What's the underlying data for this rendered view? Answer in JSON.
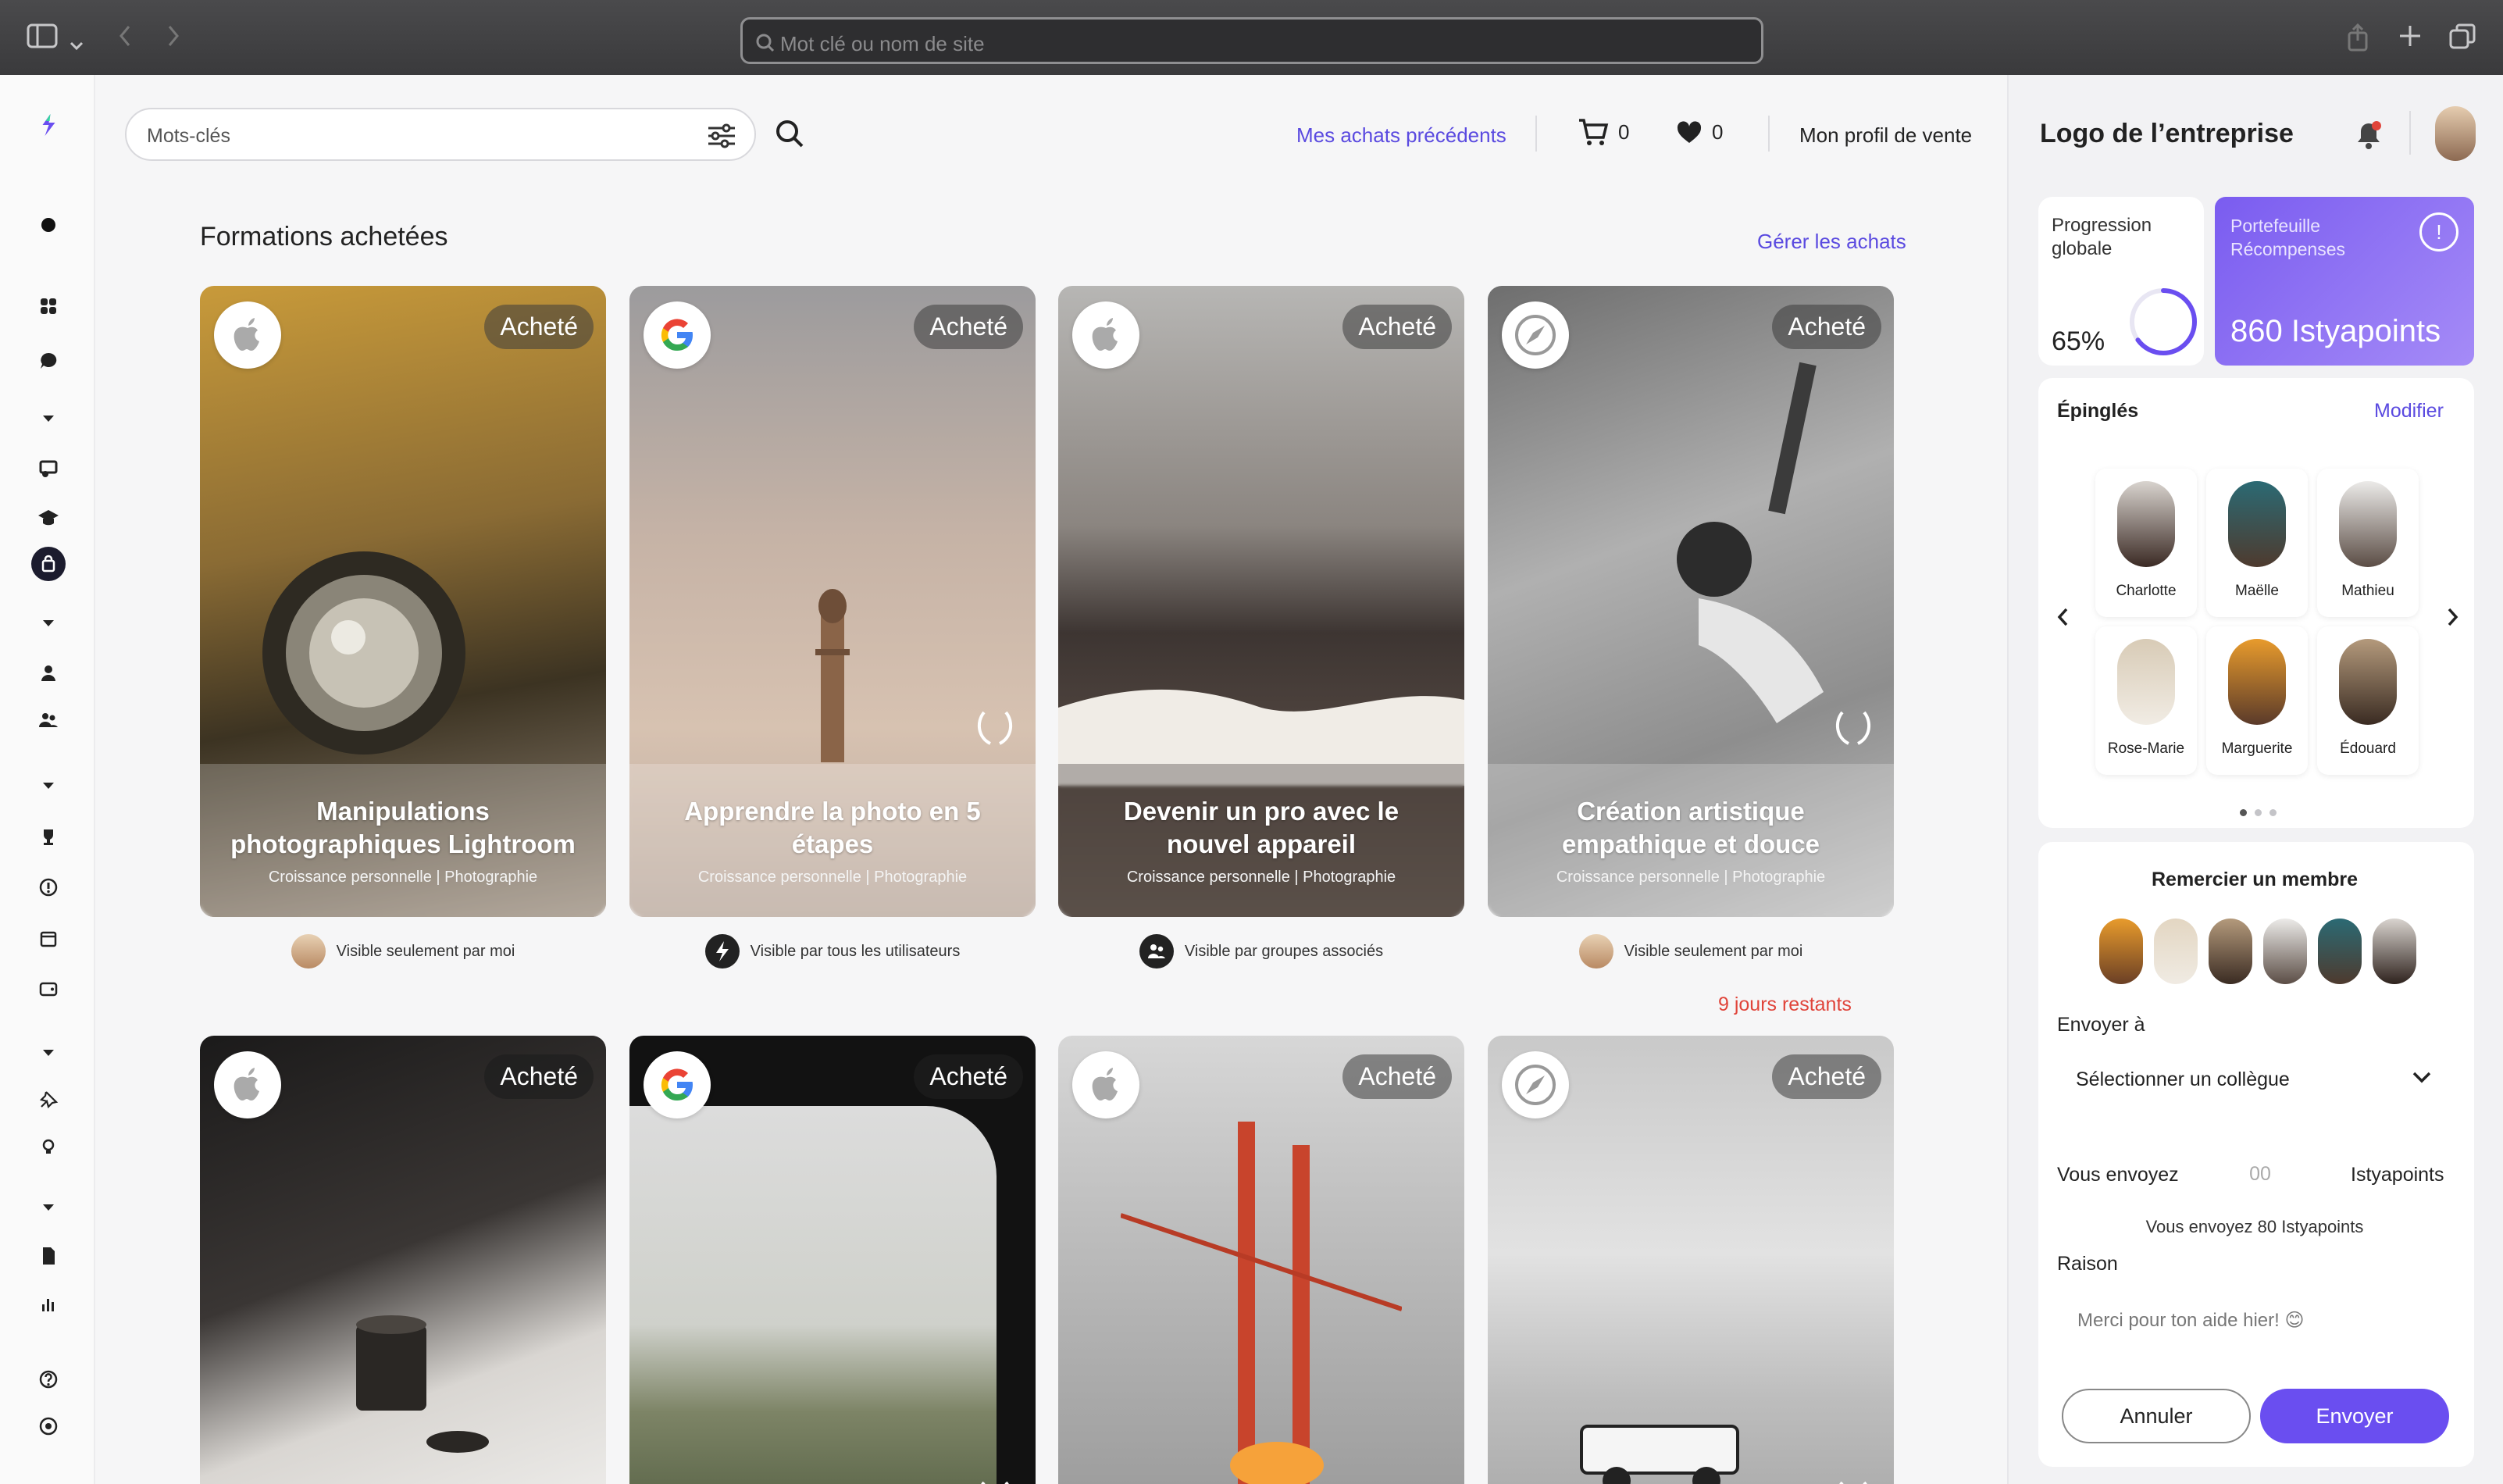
{
  "browser": {
    "address_placeholder": "Mot clé ou nom de site",
    "icons": [
      "sidebar-icon",
      "chevron-down-icon",
      "back-icon",
      "forward-icon",
      "share-icon",
      "new-tab-icon",
      "tabs-icon"
    ]
  },
  "topbar": {
    "search_placeholder": "Mots-clés",
    "previous_purchases": "Mes achats précédents",
    "cart_count": "0",
    "favorites_count": "0",
    "sales_profile": "Mon profil de vente"
  },
  "section": {
    "title": "Formations achetées",
    "manage_link": "Gérer les achats",
    "remaining": "9 jours restants"
  },
  "cards": [
    {
      "brand": "apple",
      "badge": "Acheté",
      "title": "Manipulations photographiques Lightroom",
      "subtitle": "Croissance personnelle | Photographie",
      "visibility": "Visible seulement par moi"
    },
    {
      "brand": "google",
      "badge": "Acheté",
      "title": "Apprendre la photo en 5 étapes",
      "subtitle": "Croissance personnelle | Photographie",
      "visibility": "Visible par tous les utilisateurs"
    },
    {
      "brand": "apple",
      "badge": "Acheté",
      "title": "Devenir un pro avec le nouvel appareil",
      "subtitle": "Croissance personnelle | Photographie",
      "visibility": "Visible par groupes associés"
    },
    {
      "brand": "safari",
      "badge": "Acheté",
      "title": "Création artistique empathique et douce",
      "subtitle": "Croissance personnelle | Photographie",
      "visibility": "Visible seulement par moi"
    },
    {
      "brand": "apple",
      "badge": "Acheté"
    },
    {
      "brand": "google",
      "badge": "Acheté"
    },
    {
      "brand": "apple",
      "badge": "Acheté"
    },
    {
      "brand": "safari",
      "badge": "Acheté"
    }
  ],
  "right_panel": {
    "company_logo": "Logo de l’entreprise",
    "progress": {
      "label": "Progression globale",
      "value": "65%",
      "fraction": 0.65
    },
    "wallet": {
      "label": "Portefeuille Récompenses",
      "value": "860 Istyapoints"
    },
    "pinned": {
      "title": "Épinglés",
      "edit": "Modifier",
      "people": [
        "Charlotte",
        "Maëlle",
        "Mathieu",
        "Rose-Marie",
        "Marguerite",
        "Édouard"
      ]
    },
    "thank": {
      "title": "Remercier un membre",
      "send_to_label": "Envoyer à",
      "select_value": "Sélectionner un collègue",
      "sending_label": "Vous envoyez",
      "amount_placeholder": "00",
      "unit": "Istyapoints",
      "hint": "Vous envoyez 80 Istyapoints",
      "reason_label": "Raison",
      "reason_placeholder": "Merci pour ton aide hier! 😊",
      "cancel": "Annuler",
      "send": "Envoyer"
    }
  },
  "colors": {
    "accent": "#6a4ef0",
    "link": "#5a4ae0",
    "warning": "#e0443a"
  }
}
